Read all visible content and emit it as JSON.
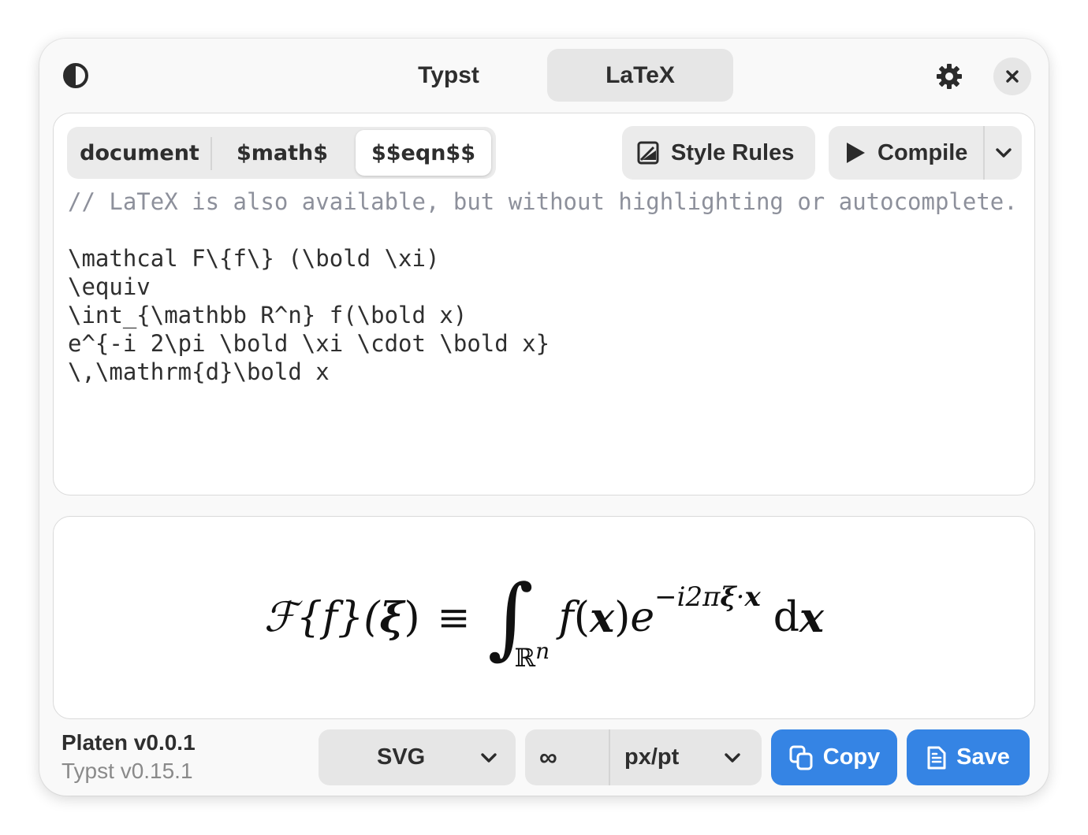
{
  "header": {
    "tabs": [
      {
        "label": "Typst",
        "active": false
      },
      {
        "label": "LaTeX",
        "active": true
      }
    ],
    "theme_icon": "contrast-icon",
    "settings_icon": "gear-icon",
    "close_icon": "close-icon"
  },
  "editor": {
    "modes": [
      {
        "label": "document",
        "active": false
      },
      {
        "label": "$math$",
        "active": false
      },
      {
        "label": "$$eqn$$",
        "active": true
      }
    ],
    "style_rules_label": "Style Rules",
    "compile_label": "Compile",
    "code_comment": "// LaTeX is also available, but without highlighting or autocomplete.",
    "code_lines": [
      "\\mathcal F\\{f\\} (\\bold \\xi)",
      "\\equiv",
      "\\int_{\\mathbb R^n} f(\\bold x)",
      "e^{-i 2\\pi \\bold \\xi \\cdot \\bold x}",
      "\\,\\mathrm{d}\\bold x"
    ]
  },
  "preview": {
    "lhs_script": "ℱ",
    "lhs_arg": "{f}(",
    "lhs_xi": "ξ",
    "lhs_close": ")",
    "equiv": "≡",
    "integral": "∫",
    "domain": "ℝ",
    "domain_exp": "n",
    "integrand_f": "f",
    "integrand_open": "(",
    "integrand_x": "x",
    "integrand_close": ")",
    "exp_base": "e",
    "exponent_prefix": "−i2π",
    "exponent_xi": "ξ",
    "exponent_dot": "·",
    "exponent_x": "x",
    "diff_d": "d",
    "diff_x": "x"
  },
  "footer": {
    "app_name": "Platen v0.0.1",
    "engine_version": "Typst v0.15.1",
    "format_value": "SVG",
    "scale_value": "∞",
    "unit_value": "px/pt",
    "copy_label": "Copy",
    "save_label": "Save"
  },
  "colors": {
    "accent": "#3584e4",
    "window_bg": "#f9f9f9",
    "comment": "#8d909b"
  }
}
